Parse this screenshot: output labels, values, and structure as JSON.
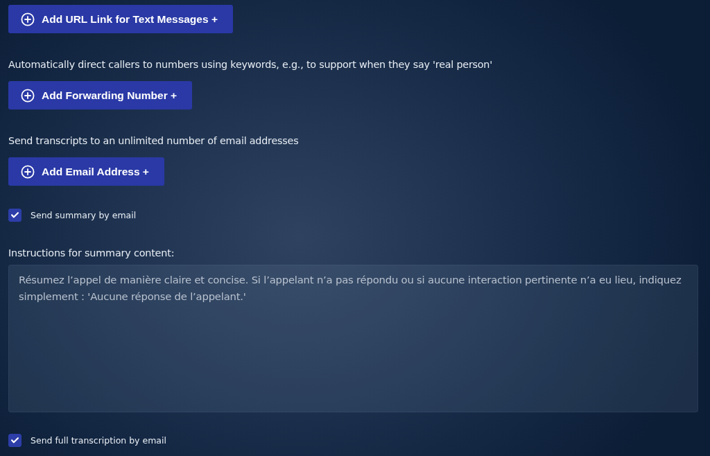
{
  "items": [
    {
      "kind": "button",
      "label": "Add URL Link for Text Messages +"
    },
    {
      "kind": "text",
      "text": "Automatically direct callers to numbers using keywords, e.g., to support when they say 'real person'"
    },
    {
      "kind": "button",
      "label": "Add Forwarding Number +"
    },
    {
      "kind": "text",
      "text": "Send transcripts to an unlimited number of email addresses"
    },
    {
      "kind": "button",
      "label": "Add Email Address +"
    },
    {
      "kind": "checkbox",
      "label": "Send summary by email",
      "checked": true
    },
    {
      "kind": "textarea",
      "label": "Instructions for summary content:",
      "value": "Résumez l’appel de manière claire et concise. Si l’appelant n’a pas répondu ou si aucune interaction pertinente n’a eu lieu, indiquez simplement : 'Aucune réponse de l’appelant.'"
    },
    {
      "kind": "checkbox",
      "label": "Send full transcription by email",
      "checked": true
    }
  ]
}
